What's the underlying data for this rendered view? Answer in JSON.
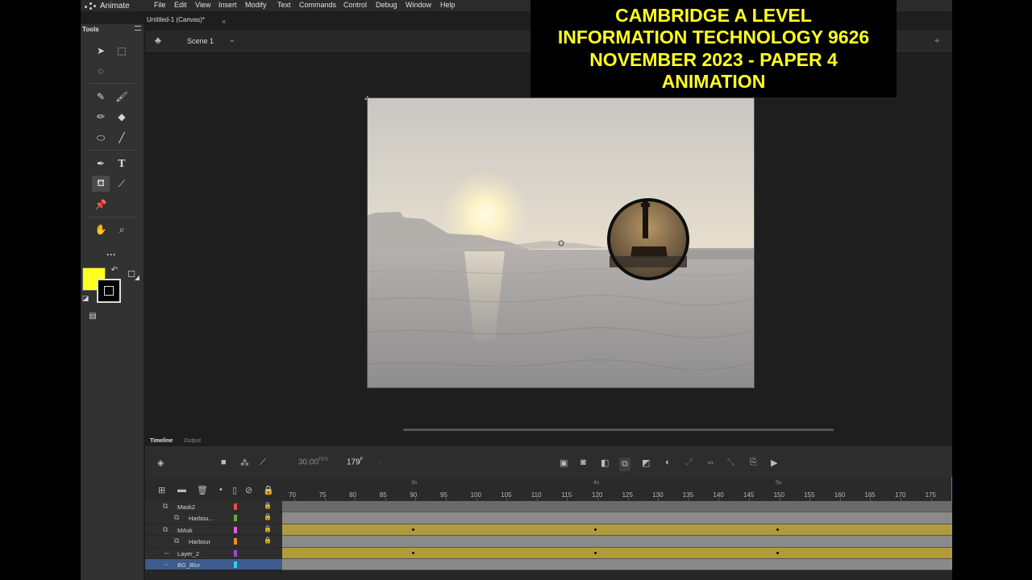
{
  "app": {
    "name": "Animate"
  },
  "menu": [
    "File",
    "Edit",
    "View",
    "Insert",
    "Modify",
    "Text",
    "Commands",
    "Control",
    "Debug",
    "Window",
    "Help"
  ],
  "tools_panel": {
    "title": "Tools"
  },
  "document": {
    "tab_title": "Untitled-1 (Canvas)*",
    "close": "×",
    "scene": "Scene 1"
  },
  "colors": {
    "fill": "#ffff20",
    "stroke": "#000000",
    "accent": "#3d7ff0"
  },
  "overlay": {
    "lines": [
      "CAMBRIDGE A LEVEL",
      "INFORMATION TECHNOLOGY 9626",
      "NOVEMBER 2023 - PAPER 4",
      "ANIMATION"
    ]
  },
  "timeline": {
    "tabs": {
      "timeline": "Timeline",
      "output": "Output"
    },
    "fps": "30.00",
    "fps_unit": "FPS",
    "frame": "179",
    "frame_unit": "F",
    "ruler_numbers": [
      "70",
      "75",
      "80",
      "85",
      "90",
      "95",
      "100",
      "105",
      "110",
      "115",
      "120",
      "125",
      "130",
      "135",
      "140",
      "145",
      "150",
      "155",
      "160",
      "165",
      "170",
      "175"
    ],
    "ruler_seconds": [
      "3s",
      "4s",
      "5s"
    ],
    "layers": [
      {
        "name": "Mask2",
        "color": "#e84c4c"
      },
      {
        "name": "Harbou...",
        "color": "#58b03a"
      },
      {
        "name": "MAsk",
        "color": "#e060e0"
      },
      {
        "name": "Harbour",
        "color": "#e8902a"
      },
      {
        "name": "Layer_2",
        "color": "#9a4ad8"
      },
      {
        "name": "BG_Blur",
        "color": "#30d0f0"
      }
    ]
  }
}
